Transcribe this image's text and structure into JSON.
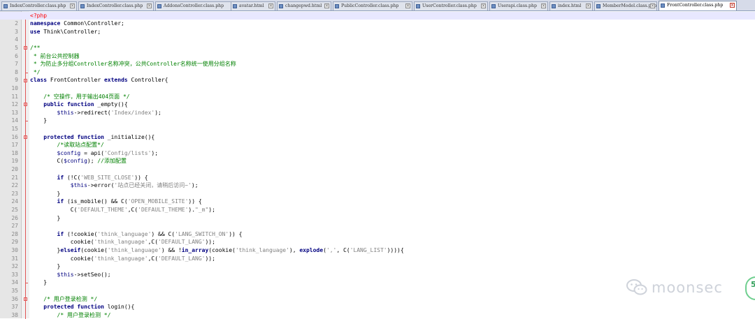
{
  "tabs": [
    {
      "label": "IndexController.class.php",
      "active": false
    },
    {
      "label": "IndexController.class.php",
      "active": false
    },
    {
      "label": "AddonsController.class.php",
      "active": false
    },
    {
      "label": "avatar.html",
      "active": false
    },
    {
      "label": "changepwd.html",
      "active": false
    },
    {
      "label": "PublicController.class.php",
      "active": false
    },
    {
      "label": "UserController.class.php",
      "active": false
    },
    {
      "label": "Userapi.class.php",
      "active": false
    },
    {
      "label": "index.html",
      "active": false
    },
    {
      "label": "MemberModel.class.php",
      "active": false
    },
    {
      "label": "FrontController.class.php",
      "active": true
    }
  ],
  "line_numbers": [
    "1",
    "2",
    "3",
    "4",
    "5",
    "6",
    "7",
    "8",
    "9",
    "10",
    "11",
    "12",
    "13",
    "14",
    "15",
    "16",
    "17",
    "18",
    "19",
    "20",
    "21",
    "22",
    "23",
    "24",
    "25",
    "26",
    "27",
    "28",
    "29",
    "30",
    "31",
    "32",
    "33",
    "34",
    "35",
    "36",
    "37",
    "38"
  ],
  "code_lines": [
    [
      [
        "tg",
        "<?php"
      ]
    ],
    [
      [
        "kw",
        "namespace"
      ],
      [
        "nb",
        " Common\\Controller;"
      ]
    ],
    [
      [
        "kw",
        "use"
      ],
      [
        "nb",
        " Think\\Controller;"
      ]
    ],
    [],
    [
      [
        "cm",
        "/**"
      ]
    ],
    [
      [
        "cm",
        " * 前台公共控制器"
      ]
    ],
    [
      [
        "cm",
        " * 为防止多分组Controller名称冲突，公共Controller名称统一使用分组名称"
      ]
    ],
    [
      [
        "cm",
        " */"
      ]
    ],
    [
      [
        "kw",
        "class"
      ],
      [
        "nb",
        " FrontController "
      ],
      [
        "kw",
        "extends"
      ],
      [
        "nb",
        " Controller{"
      ]
    ],
    [],
    [
      [
        "nb",
        "    "
      ],
      [
        "cm",
        "/* 空操作，用于输出404页面 */"
      ]
    ],
    [
      [
        "nb",
        "    "
      ],
      [
        "kw",
        "public function"
      ],
      [
        "nb",
        " _empty(){"
      ]
    ],
    [
      [
        "nb",
        "        "
      ],
      [
        "vr",
        "$this"
      ],
      [
        "nb",
        "->redirect("
      ],
      [
        "st",
        "'Index/index'"
      ],
      [
        "nb",
        ");"
      ]
    ],
    [
      [
        "nb",
        "    }"
      ]
    ],
    [],
    [
      [
        "nb",
        "    "
      ],
      [
        "kw",
        "protected function"
      ],
      [
        "nb",
        " _initialize(){"
      ]
    ],
    [
      [
        "nb",
        "        "
      ],
      [
        "cm",
        "/*读取站点配置*/"
      ]
    ],
    [
      [
        "nb",
        "        "
      ],
      [
        "vr",
        "$config"
      ],
      [
        "nb",
        " = api("
      ],
      [
        "st",
        "'Config/lists'"
      ],
      [
        "nb",
        ");"
      ]
    ],
    [
      [
        "nb",
        "        C("
      ],
      [
        "vr",
        "$config"
      ],
      [
        "nb",
        "); "
      ],
      [
        "cm",
        "//添加配置"
      ]
    ],
    [],
    [
      [
        "nb",
        "        "
      ],
      [
        "kw",
        "if"
      ],
      [
        "nb",
        " (!C("
      ],
      [
        "st",
        "'WEB_SITE_CLOSE'"
      ],
      [
        "nb",
        ")) {"
      ]
    ],
    [
      [
        "nb",
        "            "
      ],
      [
        "vr",
        "$this"
      ],
      [
        "nb",
        "->error("
      ],
      [
        "st",
        "'站点已经关闭，请稍后访问~'"
      ],
      [
        "nb",
        ");"
      ]
    ],
    [
      [
        "nb",
        "        }"
      ]
    ],
    [
      [
        "nb",
        "        "
      ],
      [
        "kw",
        "if"
      ],
      [
        "nb",
        " (is_mobile() && C("
      ],
      [
        "st",
        "'OPEN_MOBILE_SITE'"
      ],
      [
        "nb",
        ")) {"
      ]
    ],
    [
      [
        "nb",
        "            C("
      ],
      [
        "st",
        "'DEFAULT_THEME'"
      ],
      [
        "nb",
        ",C("
      ],
      [
        "st",
        "'DEFAULT_THEME'"
      ],
      [
        "nb",
        ")."
      ],
      [
        "st",
        "\"_m\""
      ],
      [
        "nb",
        ");"
      ]
    ],
    [
      [
        "nb",
        "        }"
      ]
    ],
    [],
    [
      [
        "nb",
        "        "
      ],
      [
        "kw",
        "if"
      ],
      [
        "nb",
        " (!cookie("
      ],
      [
        "st",
        "'think_language'"
      ],
      [
        "nb",
        ") && C("
      ],
      [
        "st",
        "'LANG_SWITCH_ON'"
      ],
      [
        "nb",
        ")) {"
      ]
    ],
    [
      [
        "nb",
        "            cookie("
      ],
      [
        "st",
        "'think_language'"
      ],
      [
        "nb",
        ",C("
      ],
      [
        "st",
        "'DEFAULT_LANG'"
      ],
      [
        "nb",
        "));"
      ]
    ],
    [
      [
        "nb",
        "        }"
      ],
      [
        "kw",
        "elseif"
      ],
      [
        "nb",
        "(cookie("
      ],
      [
        "st",
        "'think_language'"
      ],
      [
        "nb",
        ") && !"
      ],
      [
        "kw",
        "in_array"
      ],
      [
        "nb",
        "(cookie("
      ],
      [
        "st",
        "'think_language'"
      ],
      [
        "nb",
        "), "
      ],
      [
        "kw",
        "explode"
      ],
      [
        "nb",
        "("
      ],
      [
        "st",
        "','"
      ],
      [
        "nb",
        ", C("
      ],
      [
        "st",
        "'LANG_LIST'"
      ],
      [
        "nb",
        ")))){"
      ]
    ],
    [
      [
        "nb",
        "            cookie("
      ],
      [
        "st",
        "'think_language'"
      ],
      [
        "nb",
        ",C("
      ],
      [
        "st",
        "'DEFAULT_LANG'"
      ],
      [
        "nb",
        "));"
      ]
    ],
    [
      [
        "nb",
        "        }"
      ]
    ],
    [
      [
        "nb",
        "        "
      ],
      [
        "vr",
        "$this"
      ],
      [
        "nb",
        "->setSeo();"
      ]
    ],
    [
      [
        "nb",
        "    }"
      ]
    ],
    [],
    [
      [
        "nb",
        "    "
      ],
      [
        "cm",
        "/* 用户登录检测 */"
      ]
    ],
    [
      [
        "nb",
        "    "
      ],
      [
        "kw",
        "protected function"
      ],
      [
        "nb",
        " login(){"
      ]
    ],
    [
      [
        "nb",
        "        "
      ],
      [
        "cm",
        "/* 用户登录检测 */"
      ]
    ]
  ],
  "watermark": {
    "text": "moonsec",
    "icon": "wechat-icon"
  },
  "side_badge": {
    "text": "5"
  },
  "colors": {
    "keyword": "#000080",
    "comment": "#008000",
    "string": "#808080",
    "tag": "#ff0000",
    "fold_marker": "#e05555",
    "current_line": "#e8e8ff"
  }
}
